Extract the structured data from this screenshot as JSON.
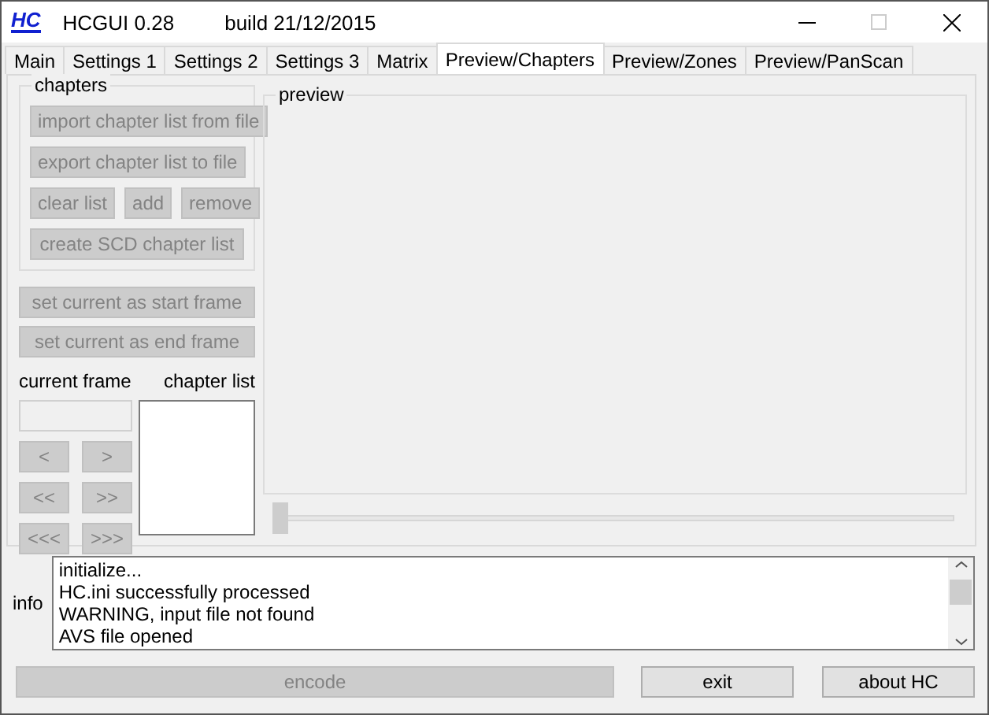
{
  "window": {
    "logo": "HC",
    "title": "HCGUI 0.28",
    "build": "build 21/12/2015"
  },
  "tabs": [
    {
      "label": "Main",
      "selected": false
    },
    {
      "label": "Settings 1",
      "selected": false
    },
    {
      "label": "Settings 2",
      "selected": false
    },
    {
      "label": "Settings 3",
      "selected": false
    },
    {
      "label": "Matrix",
      "selected": false
    },
    {
      "label": "Preview/Chapters",
      "selected": true
    },
    {
      "label": "Preview/Zones",
      "selected": false
    },
    {
      "label": "Preview/PanScan",
      "selected": false
    }
  ],
  "chapters": {
    "title": "chapters",
    "rows": [
      [
        {
          "label": "import chapter list from file",
          "disabled": true
        }
      ],
      [
        {
          "label": "export chapter list to file",
          "disabled": true
        }
      ],
      [
        {
          "label": "clear list",
          "disabled": true
        },
        {
          "label": "add",
          "disabled": true
        },
        {
          "label": "remove",
          "disabled": true
        }
      ],
      [
        {
          "label": "create SCD chapter list",
          "disabled": true
        }
      ]
    ]
  },
  "frame_buttons": [
    {
      "label": "set current as start frame",
      "disabled": true
    },
    {
      "label": "set current as end frame",
      "disabled": true
    }
  ],
  "current_frame": {
    "label": "current frame"
  },
  "chapter_list": {
    "label": "chapter list"
  },
  "nav_buttons": [
    {
      "label": "<",
      "disabled": true
    },
    {
      "label": ">",
      "disabled": true
    },
    {
      "label": "<<",
      "disabled": true
    },
    {
      "label": ">>",
      "disabled": true
    },
    {
      "label": "<<<",
      "disabled": true
    },
    {
      "label": ">>>",
      "disabled": true
    }
  ],
  "preview": {
    "title": "preview",
    "slider": {
      "level": 0
    }
  },
  "info": {
    "label": "info",
    "lines": [
      "initialize...",
      "HC.ini successfully processed",
      "WARNING, input file not found",
      "AVS file opened"
    ]
  },
  "bottom_buttons": [
    {
      "label": "encode",
      "disabled": true
    },
    {
      "label": "exit",
      "disabled": false
    },
    {
      "label": "about HC",
      "disabled": false
    }
  ]
}
